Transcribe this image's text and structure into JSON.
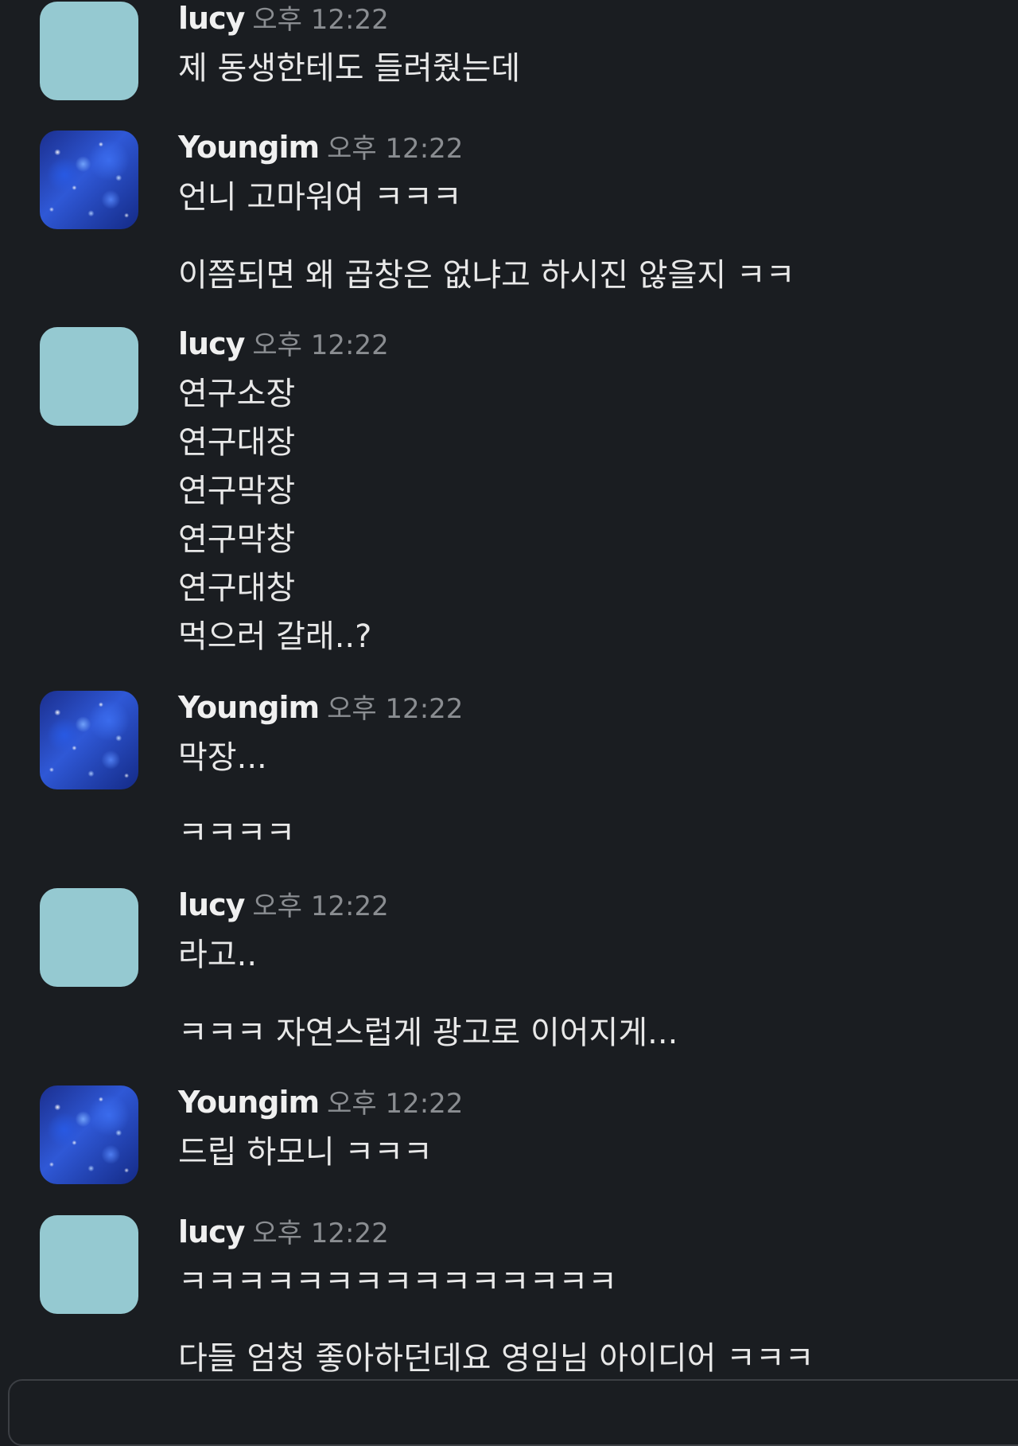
{
  "messages": [
    {
      "author": "lucy",
      "time": "오후 12:22",
      "lines": [
        "제 동생한테도 들려줬는데"
      ]
    },
    {
      "author": "Youngim",
      "time": "오후 12:22",
      "lines": [
        "언니 고마워여 ㅋㅋㅋ",
        "이쯤되면 왜 곱창은 없냐고 하시진 않을지 ㅋㅋ"
      ]
    },
    {
      "author": "lucy",
      "time": "오후 12:22",
      "lines": [
        "연구소장",
        "연구대장",
        "연구막장",
        "연구막창",
        "연구대창",
        "먹으러 갈래..?"
      ]
    },
    {
      "author": "Youngim",
      "time": "오후 12:22",
      "lines": [
        "막장...",
        "ㅋㅋㅋㅋ"
      ]
    },
    {
      "author": "lucy",
      "time": "오후 12:22",
      "lines": [
        "라고..",
        "ㅋㅋㅋ 자연스럽게 광고로 이어지게..."
      ]
    },
    {
      "author": "Youngim",
      "time": "오후 12:22",
      "lines": [
        "드립 하모니 ㅋㅋㅋ"
      ]
    },
    {
      "author": "lucy",
      "time": "오후 12:22",
      "lines": [
        "ㅋㅋㅋㅋㅋㅋㅋㅋㅋㅋㅋㅋㅋㅋㅋ",
        "다들 엄청 좋아하던데요 영임님 아이디어 ㅋㅋㅋ"
      ]
    }
  ],
  "colors": {
    "background": "#1a1d21",
    "lucy_avatar": "#95c9d1",
    "youngim_avatar": "#1e3fa8",
    "timestamp": "#8a8d91"
  }
}
